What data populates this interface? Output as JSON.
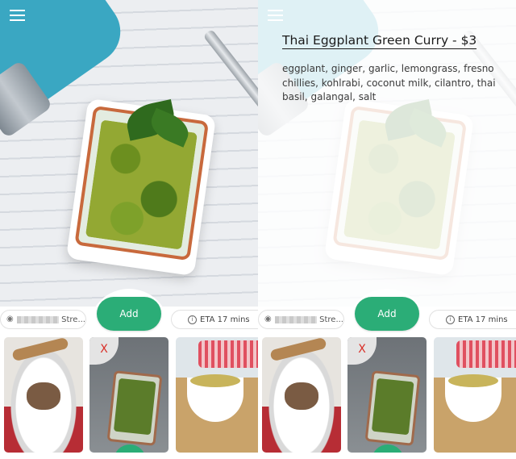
{
  "panes": [
    {
      "overlay": false,
      "menu_icon": "hamburger-menu-icon",
      "location": {
        "street": "Stre...",
        "icon": "map-pin-icon"
      },
      "add_label": "Add",
      "eta": {
        "text": "ETA 17 mins",
        "icon": "info-clock-icon"
      },
      "remove_label": "X",
      "thumbs": [
        {
          "name": "braised-dish-thumbnail"
        },
        {
          "name": "green-curry-thumbnail"
        },
        {
          "name": "yellow-curry-thumbnail"
        }
      ]
    },
    {
      "overlay": true,
      "menu_icon": "hamburger-menu-icon",
      "dish": {
        "title": "Thai Eggplant Green Curry - $3",
        "ingredients": "eggplant, ginger, garlic, lemongrass, fresno chillies, kohlrabi, coconut milk, cilantro, thai basil, galangal, salt"
      },
      "location": {
        "street": "Stre...",
        "icon": "map-pin-icon"
      },
      "add_label": "Add",
      "eta": {
        "text": "ETA 17 mins",
        "icon": "info-clock-icon"
      },
      "remove_label": "X",
      "thumbs": [
        {
          "name": "braised-dish-thumbnail"
        },
        {
          "name": "green-curry-thumbnail"
        },
        {
          "name": "yellow-curry-thumbnail"
        }
      ]
    }
  ],
  "colors": {
    "accent": "#2bad77",
    "remove": "#d92f28",
    "text": "#1b1b1b"
  }
}
